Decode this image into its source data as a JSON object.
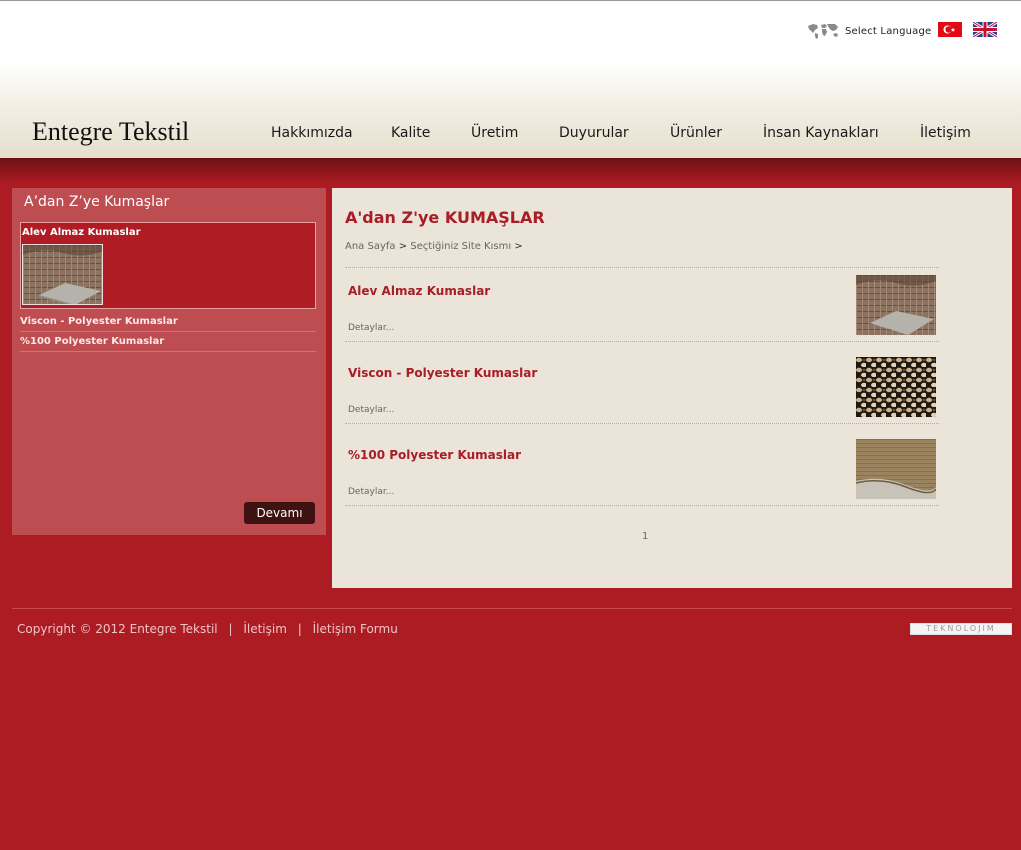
{
  "header": {
    "logo": "Entegre Tekstil",
    "language_label": "Select Language",
    "nav": [
      "Hakkımızda",
      "Kalite",
      "Üretim",
      "Duyurular",
      "Ürünler",
      "İnsan Kaynakları",
      "İletişim"
    ]
  },
  "sidebar": {
    "title": "A’dan Z’ye Kumaşlar",
    "featured_label": "Alev Almaz Kumaslar",
    "items": [
      "Viscon - Polyester Kumaslar",
      "%100 Polyester Kumaslar"
    ],
    "button_label": "Devamı"
  },
  "main": {
    "title": "A'dan Z'ye KUMAŞLAR",
    "breadcrumb": [
      "Ana Sayfa",
      "Seçtiğiniz Site Kısmı"
    ],
    "breadcrumb_sep": ">",
    "products": [
      {
        "title": "Alev Almaz Kumaslar",
        "details": "Detaylar..."
      },
      {
        "title": "Viscon - Polyester Kumaslar",
        "details": "Detaylar..."
      },
      {
        "title": "%100 Polyester Kumaslar",
        "details": "Detaylar..."
      }
    ],
    "pagination": "1"
  },
  "footer": {
    "copyright": "Copyright © 2012 Entegre Tekstil",
    "sep": "|",
    "links": [
      "İletişim",
      "İletişim Formu"
    ],
    "badge": "TEKNOLOJIM"
  },
  "colors": {
    "background": "#ad1c22",
    "accent": "#a81d26",
    "content_bg": "#ebe4d9",
    "sidebar_bg": "#be4d52",
    "button": "#3e1210"
  },
  "icons": [
    "world-map-icon",
    "turkey-flag-icon",
    "uk-flag-icon"
  ]
}
